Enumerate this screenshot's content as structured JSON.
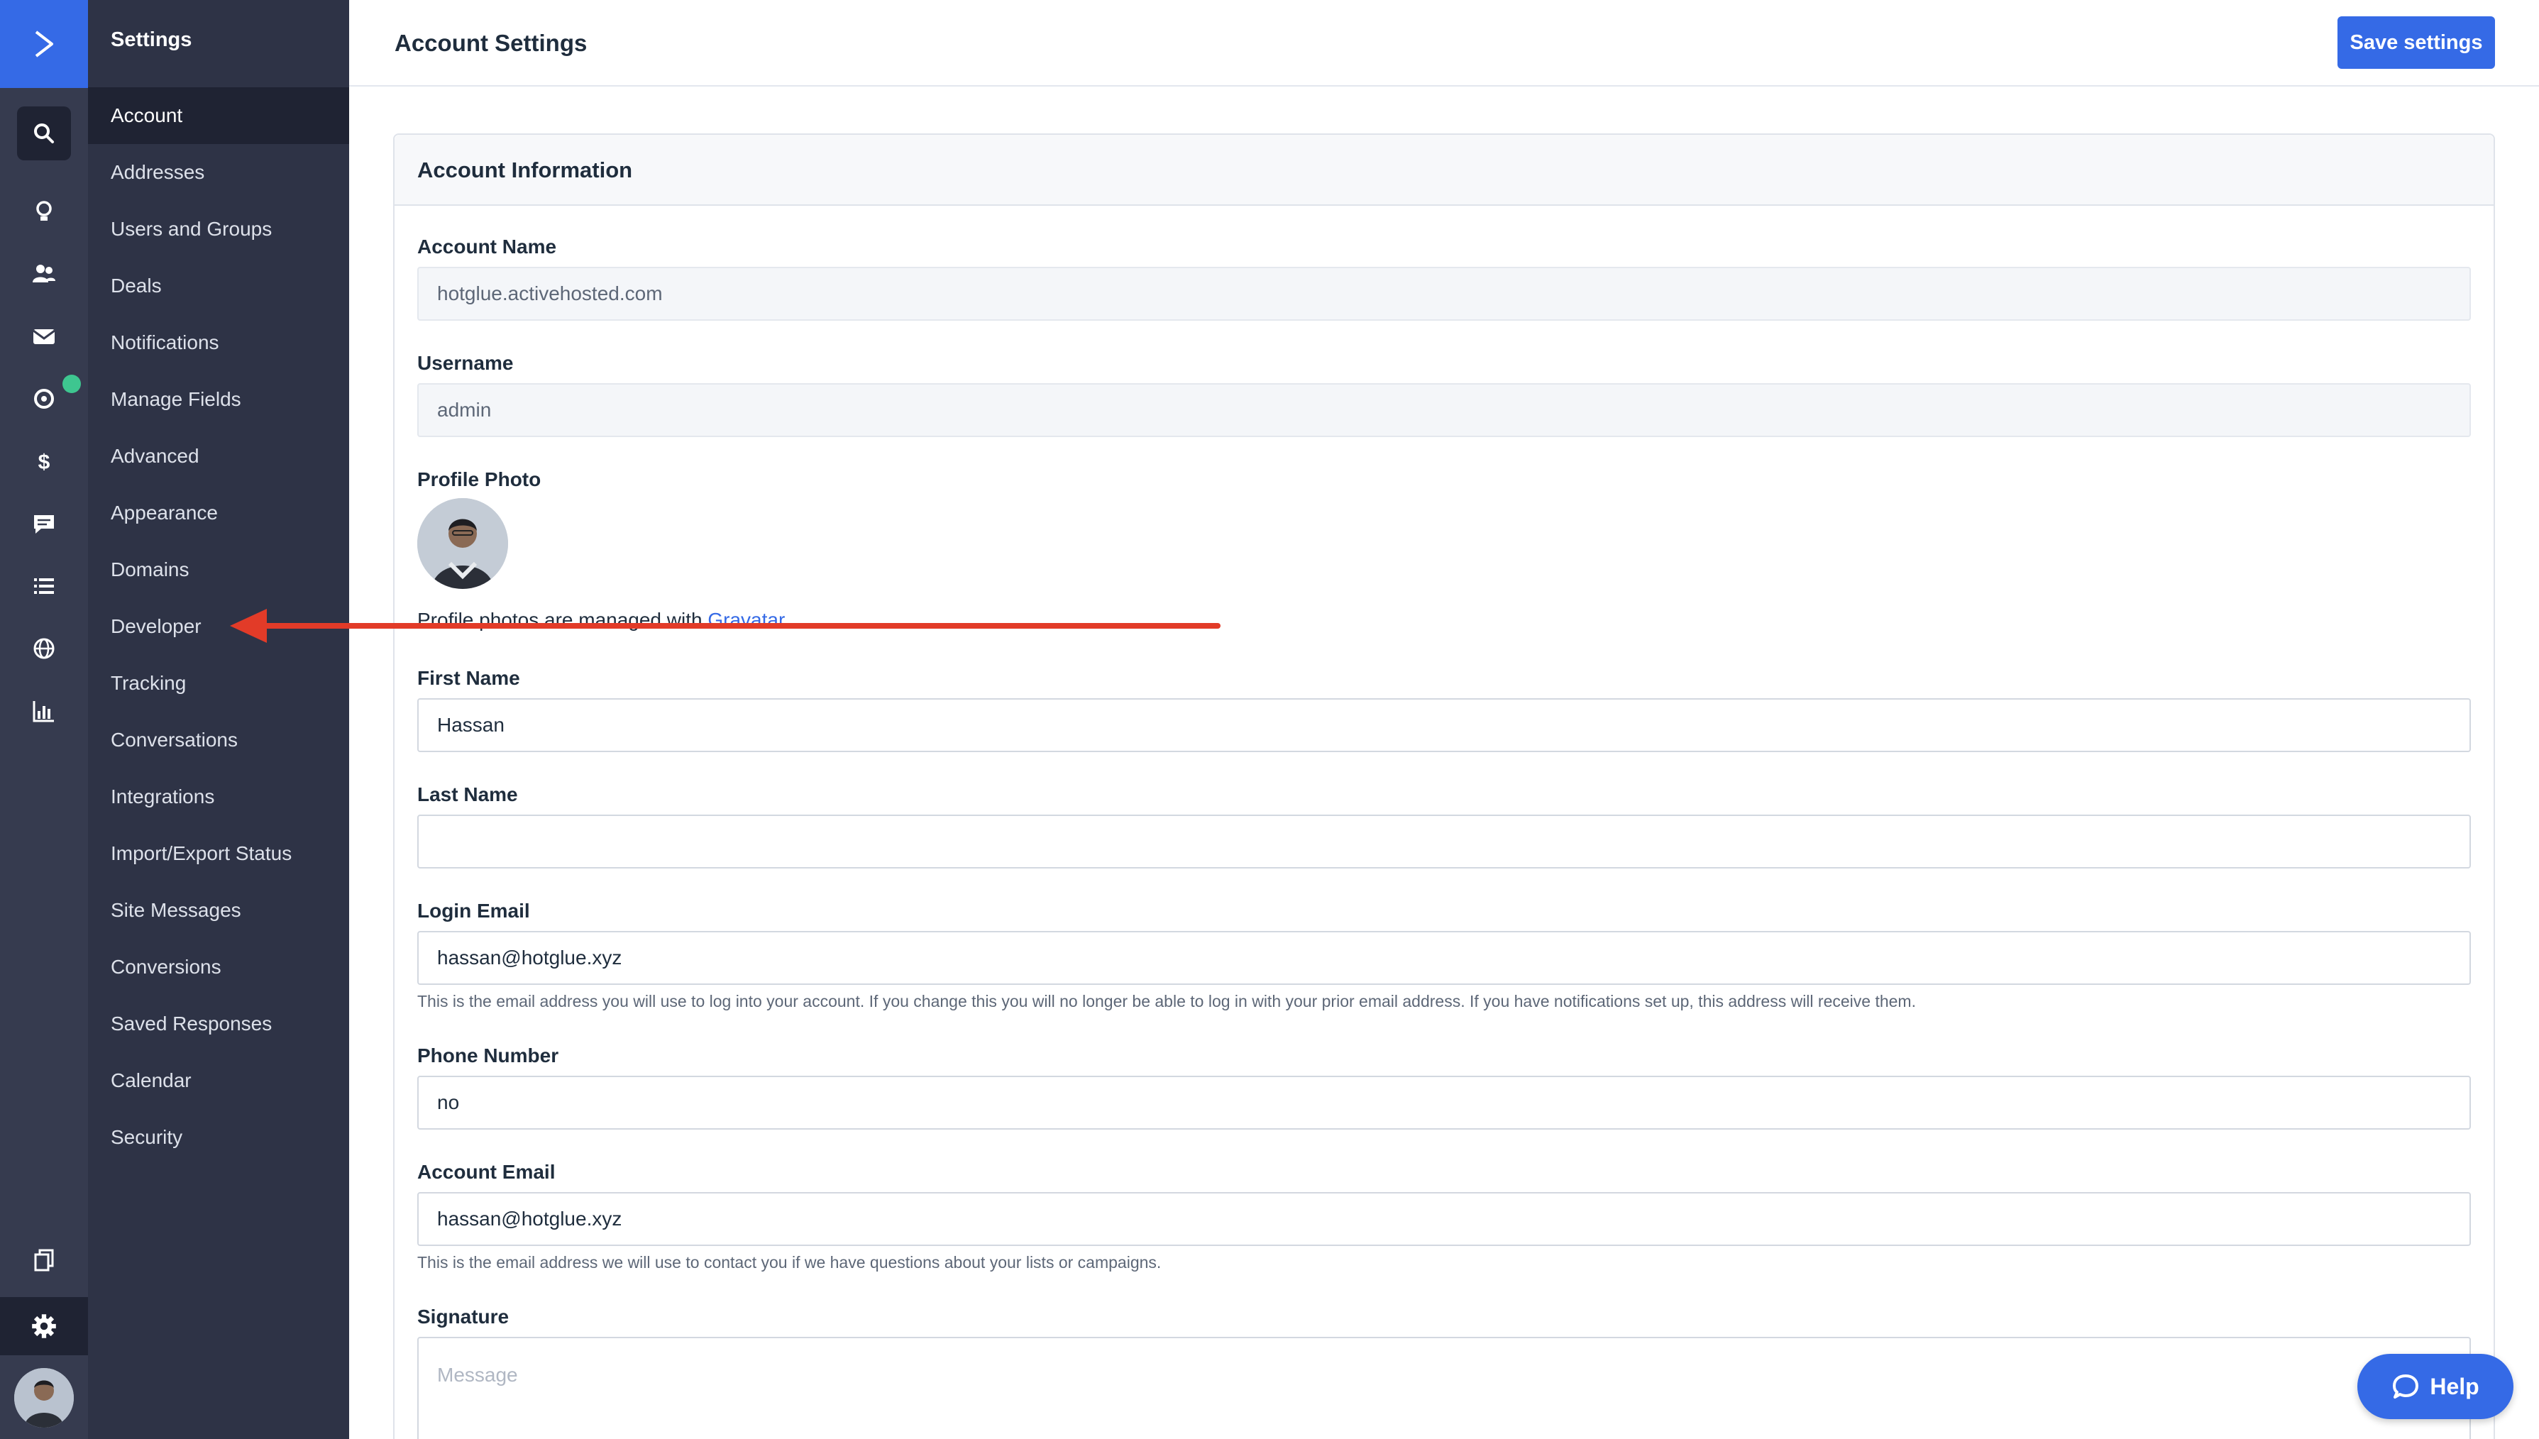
{
  "sidebar": {
    "title": "Settings",
    "items": [
      {
        "label": "Account"
      },
      {
        "label": "Addresses"
      },
      {
        "label": "Users and Groups"
      },
      {
        "label": "Deals"
      },
      {
        "label": "Notifications"
      },
      {
        "label": "Manage Fields"
      },
      {
        "label": "Advanced"
      },
      {
        "label": "Appearance"
      },
      {
        "label": "Domains"
      },
      {
        "label": "Developer"
      },
      {
        "label": "Tracking"
      },
      {
        "label": "Conversations"
      },
      {
        "label": "Integrations"
      },
      {
        "label": "Import/Export Status"
      },
      {
        "label": "Site Messages"
      },
      {
        "label": "Conversions"
      },
      {
        "label": "Saved Responses"
      },
      {
        "label": "Calendar"
      },
      {
        "label": "Security"
      }
    ],
    "active_item": "Account"
  },
  "rail": {
    "icons": [
      "logo-icon",
      "search-icon",
      "lightbulb-icon",
      "contacts-icon",
      "email-icon",
      "automation-icon",
      "dollar-icon",
      "chat-icon",
      "list-icon",
      "globe-icon",
      "chart-icon",
      "pages-icon",
      "gear-icon"
    ]
  },
  "header": {
    "title": "Account Settings",
    "save_label": "Save settings"
  },
  "card": {
    "title": "Account Information"
  },
  "form": {
    "account_name": {
      "label": "Account Name",
      "value": "hotglue.activehosted.com"
    },
    "username": {
      "label": "Username",
      "value": "admin"
    },
    "profile_photo": {
      "label": "Profile Photo",
      "note_prefix": "Profile photos are managed with ",
      "link": "Gravatar"
    },
    "first_name": {
      "label": "First Name",
      "value": "Hassan"
    },
    "last_name": {
      "label": "Last Name",
      "value": ""
    },
    "login_email": {
      "label": "Login Email",
      "value": "hassan@hotglue.xyz",
      "hint": "This is the email address you will use to log into your account. If you change this you will no longer be able to log in with your prior email address. If you have notifications set up, this address will receive them."
    },
    "phone": {
      "label": "Phone Number",
      "value": "no"
    },
    "account_email": {
      "label": "Account Email",
      "value": "hassan@hotglue.xyz",
      "hint": "This is the email address we will use to contact you if we have questions about your lists or campaigns."
    },
    "signature": {
      "label": "Signature",
      "placeholder": "Message"
    }
  },
  "help": {
    "label": "Help"
  },
  "colors": {
    "accent": "#356ae6",
    "rail": "#363b4f",
    "sidebar": "#2e3346",
    "annotation_arrow": "#e23b28",
    "status_dot": "#3ec690"
  }
}
